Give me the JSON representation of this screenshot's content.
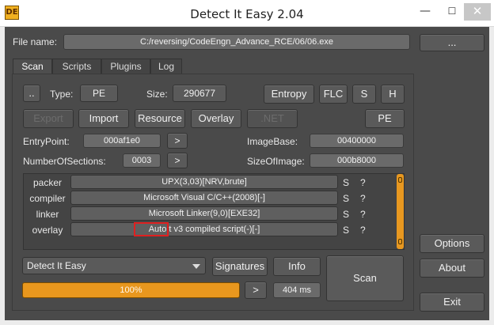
{
  "window": {
    "title": "Detect It Easy 2.04",
    "app_icon_text": "DE",
    "min_symbol": "—",
    "max_symbol": "☐",
    "close_symbol": "✕"
  },
  "file": {
    "label": "File name:",
    "path": "C:/reversing/CodeEngn_Advance_RCE/06/06.exe",
    "browse_label": "..."
  },
  "tabs": [
    "Scan",
    "Scripts",
    "Plugins",
    "Log"
  ],
  "scan": {
    "dots_label": "..",
    "type_label": "Type:",
    "type_value": "PE",
    "size_label": "Size:",
    "size_value": "290677",
    "entropy_label": "Entropy",
    "flc_label": "FLC",
    "s_label": "S",
    "h_label": "H",
    "export_label": "Export",
    "import_label": "Import",
    "resource_label": "Resource",
    "overlay_label": "Overlay",
    "net_label": ".NET",
    "pe_label": "PE",
    "entrypoint_label": "EntryPoint:",
    "entrypoint_value": "000af1e0",
    "imagebase_label": "ImageBase:",
    "imagebase_value": "00400000",
    "sections_label": "NumberOfSections:",
    "sections_value": "0003",
    "imagesize_label": "SizeOfImage:",
    "imagesize_value": "000b8000",
    "arrow_label": ">"
  },
  "detections": [
    {
      "type": "packer",
      "value": "UPX(3,03)[NRV,brute]",
      "s": "S",
      "q": "?"
    },
    {
      "type": "compiler",
      "value": "Microsoft Visual C/C++(2008)[-]",
      "s": "S",
      "q": "?"
    },
    {
      "type": "linker",
      "value": "Microsoft Linker(9,0)[EXE32]",
      "s": "S",
      "q": "?"
    },
    {
      "type": "overlay",
      "value": "AutoIt v3 compiled script(-)[-]",
      "s": "S",
      "q": "?"
    }
  ],
  "bottom": {
    "engine_select": "Detect It Easy",
    "signatures_label": "Signatures",
    "info_label": "Info",
    "scan_label": "Scan",
    "progress_label": "100%",
    "progress_fraction": 1.0,
    "arrow_label": ">",
    "time_label": "404 ms"
  },
  "side": {
    "options_label": "Options",
    "about_label": "About",
    "exit_label": "Exit"
  },
  "colors": {
    "background": "#4a4a4a",
    "accent": "#e8971e",
    "highlight_box": "#e02020"
  }
}
